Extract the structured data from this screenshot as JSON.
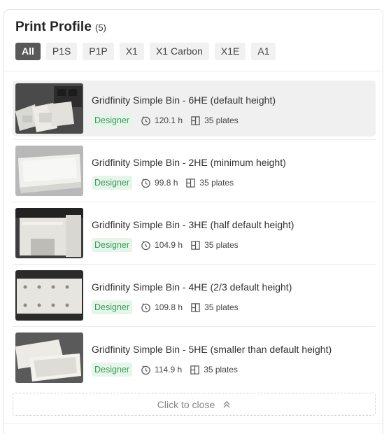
{
  "header": {
    "title": "Print Profile",
    "count": "(5)"
  },
  "filters": [
    "All",
    "P1S",
    "P1P",
    "X1",
    "X1 Carbon",
    "X1E",
    "A1"
  ],
  "profiles": [
    {
      "title": "Gridfinity Simple Bin - 6HE (default height)",
      "badge": "Designer",
      "time": "120.1 h",
      "plates": "35 plates",
      "selected": true
    },
    {
      "title": "Gridfinity Simple Bin - 2HE (minimum height)",
      "badge": "Designer",
      "time": "99.8 h",
      "plates": "35 plates"
    },
    {
      "title": "Gridfinity Simple Bin - 3HE (half default height)",
      "badge": "Designer",
      "time": "104.9 h",
      "plates": "35 plates"
    },
    {
      "title": "Gridfinity Simple Bin - 4HE (2/3 default height)",
      "badge": "Designer",
      "time": "109.8 h",
      "plates": "35 plates"
    },
    {
      "title": "Gridfinity Simple Bin - 5HE (smaller than default height)",
      "badge": "Designer",
      "time": "114.9 h",
      "plates": "35 plates"
    }
  ],
  "footer": {
    "close_label": "Click to close"
  },
  "colors": {
    "accent_badge_bg": "#e6f5ea",
    "accent_badge_text": "#3a9a57",
    "active_chip": "#595959"
  }
}
